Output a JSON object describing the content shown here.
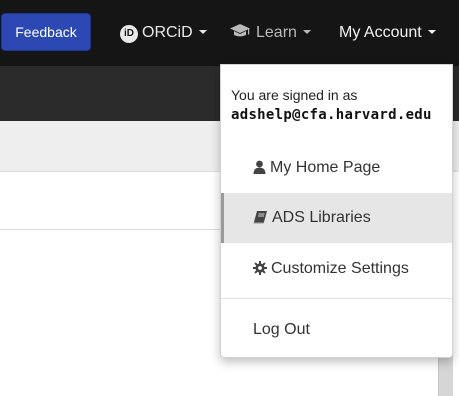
{
  "navbar": {
    "feedback_label": "Feedback",
    "orcid_label": "ORCiD",
    "orcid_badge": "iD",
    "learn_label": "Learn",
    "account_label": "My Account"
  },
  "account_menu": {
    "signed_in_text": "You are signed in as",
    "email": "adshelp@cfa.harvard.edu",
    "items": [
      {
        "label": "My Home Page",
        "icon": "user-icon"
      },
      {
        "label": "ADS Libraries",
        "icon": "book-icon",
        "active": true
      },
      {
        "label": "Customize Settings",
        "icon": "gear-icon"
      },
      {
        "label": "Log Out"
      }
    ]
  },
  "colors": {
    "navbar_bg": "#151515",
    "feedback_button": "#2c49b3",
    "active_item_bg": "#e6e6e6"
  }
}
